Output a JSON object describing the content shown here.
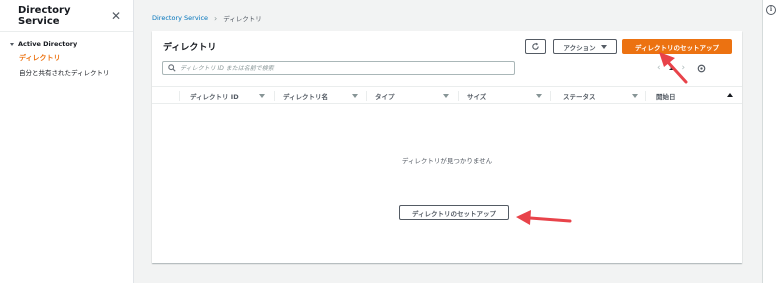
{
  "sidebar": {
    "title": "Directory Service",
    "group_label": "Active Directory",
    "items": [
      {
        "label": "ディレクトリ",
        "active": true
      },
      {
        "label": "自分と共有されたディレクトリ",
        "active": false
      }
    ]
  },
  "breadcrumb": {
    "root": "Directory Service",
    "current": "ディレクトリ"
  },
  "panel": {
    "title": "ディレクトリ",
    "actions_label": "アクション",
    "setup_label": "ディレクトリのセットアップ",
    "search_placeholder": "ディレクトリ ID または名前で検索",
    "page_number": "1",
    "columns": [
      "ディレクトリ ID",
      "ディレクトリ名",
      "タイプ",
      "サイズ",
      "ステータス",
      "開始日"
    ],
    "empty_message": "ディレクトリが見つかりません",
    "empty_setup_label": "ディレクトリのセットアップ"
  },
  "colors": {
    "primary": "#ec7211",
    "link": "#0073bb",
    "annotation_arrow": "#e8434a"
  },
  "icons": [
    "close-icon",
    "refresh-icon",
    "search-icon",
    "chevron-left-icon",
    "chevron-right-icon",
    "gear-icon",
    "info-icon",
    "caret-down-icon",
    "sort-asc-icon"
  ]
}
